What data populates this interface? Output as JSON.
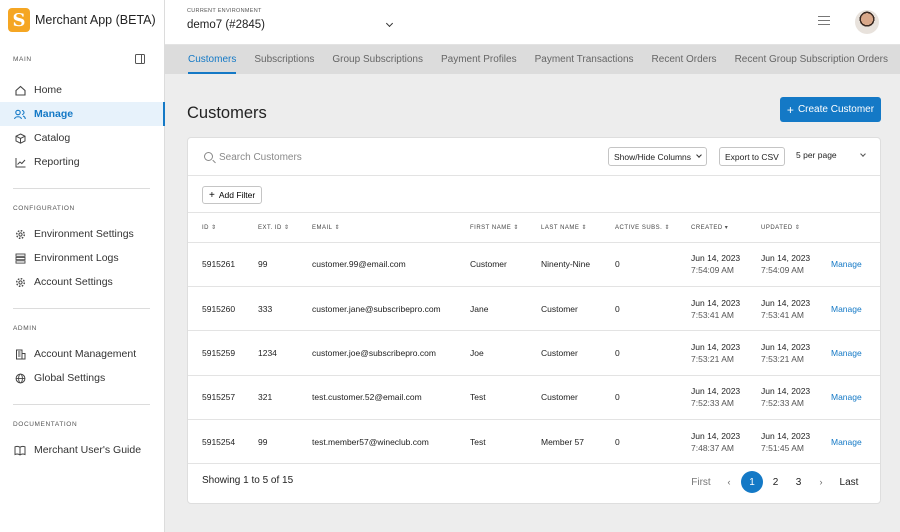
{
  "app": {
    "title": "Merchant App (BETA)",
    "logo_letter": "S",
    "brand_color": "#f5a623",
    "accent_color": "#1479c6"
  },
  "sidebar": {
    "sections": [
      {
        "label": "MAIN",
        "items": [
          {
            "label": "Home",
            "icon": "home-icon",
            "active": false
          },
          {
            "label": "Manage",
            "icon": "users-icon",
            "active": true
          },
          {
            "label": "Catalog",
            "icon": "box-icon",
            "active": false
          },
          {
            "label": "Reporting",
            "icon": "chart-line-icon",
            "active": false
          }
        ]
      },
      {
        "label": "CONFIGURATION",
        "items": [
          {
            "label": "Environment Settings",
            "icon": "gear-icon"
          },
          {
            "label": "Environment Logs",
            "icon": "logs-icon"
          },
          {
            "label": "Account Settings",
            "icon": "gear-icon"
          }
        ]
      },
      {
        "label": "ADMIN",
        "items": [
          {
            "label": "Account Management",
            "icon": "building-icon"
          },
          {
            "label": "Global Settings",
            "icon": "globe-icon"
          }
        ]
      },
      {
        "label": "DOCUMENTATION",
        "items": [
          {
            "label": "Merchant User's Guide",
            "icon": "book-icon"
          }
        ]
      }
    ]
  },
  "topbar": {
    "env_label": "CURRENT ENVIRONMENT",
    "env_value": "demo7 (#2845)"
  },
  "tabs": [
    {
      "label": "Customers",
      "active": true
    },
    {
      "label": "Subscriptions"
    },
    {
      "label": "Group Subscriptions"
    },
    {
      "label": "Payment Profiles"
    },
    {
      "label": "Payment Transactions"
    },
    {
      "label": "Recent Orders"
    },
    {
      "label": "Recent Group Subscription Orders"
    }
  ],
  "main": {
    "title": "Customers",
    "create_button": "Create Customer",
    "search_placeholder": "Search Customers",
    "show_hide_columns": "Show/Hide Columns",
    "export_csv": "Export to CSV",
    "per_page": "5 per page",
    "add_filter": "Add Filter"
  },
  "table": {
    "columns": [
      "ID",
      "EXT. ID",
      "EMAIL",
      "FIRST NAME",
      "LAST NAME",
      "ACTIVE SUBS.",
      "CREATED",
      "UPDATED"
    ],
    "sort_icons": [
      "⇕",
      "⇕",
      "⇕",
      "⇕",
      "⇕",
      "⇕",
      "▾",
      "⇕"
    ],
    "action_label": "Manage",
    "rows": [
      {
        "id": "5915261",
        "ext_id": "99",
        "email": "customer.99@email.com",
        "first": "Customer",
        "last": "Ninenty-Nine",
        "subs": "0",
        "created_date": "Jun 14, 2023",
        "created_time": "7:54:09 AM",
        "updated_date": "Jun 14, 2023",
        "updated_time": "7:54:09 AM"
      },
      {
        "id": "5915260",
        "ext_id": "333",
        "email": "customer.jane@subscribepro.com",
        "first": "Jane",
        "last": "Customer",
        "subs": "0",
        "created_date": "Jun 14, 2023",
        "created_time": "7:53:41 AM",
        "updated_date": "Jun 14, 2023",
        "updated_time": "7:53:41 AM"
      },
      {
        "id": "5915259",
        "ext_id": "1234",
        "email": "customer.joe@subscribepro.com",
        "first": "Joe",
        "last": "Customer",
        "subs": "0",
        "created_date": "Jun 14, 2023",
        "created_time": "7:53:21 AM",
        "updated_date": "Jun 14, 2023",
        "updated_time": "7:53:21 AM"
      },
      {
        "id": "5915257",
        "ext_id": "321",
        "email": "test.customer.52@email.com",
        "first": "Test",
        "last": "Customer",
        "subs": "0",
        "created_date": "Jun 14, 2023",
        "created_time": "7:52:33 AM",
        "updated_date": "Jun 14, 2023",
        "updated_time": "7:52:33 AM"
      },
      {
        "id": "5915254",
        "ext_id": "99",
        "email": "test.member57@wineclub.com",
        "first": "Test",
        "last": "Member 57",
        "subs": "0",
        "created_date": "Jun 14, 2023",
        "created_time": "7:48:37 AM",
        "updated_date": "Jun 14, 2023",
        "updated_time": "7:51:45 AM"
      }
    ]
  },
  "pagination": {
    "showing": "Showing 1 to 5 of 15",
    "first": "First",
    "prev": "‹",
    "pages": [
      "1",
      "2",
      "3"
    ],
    "current": "1",
    "next": "›",
    "last": "Last"
  }
}
